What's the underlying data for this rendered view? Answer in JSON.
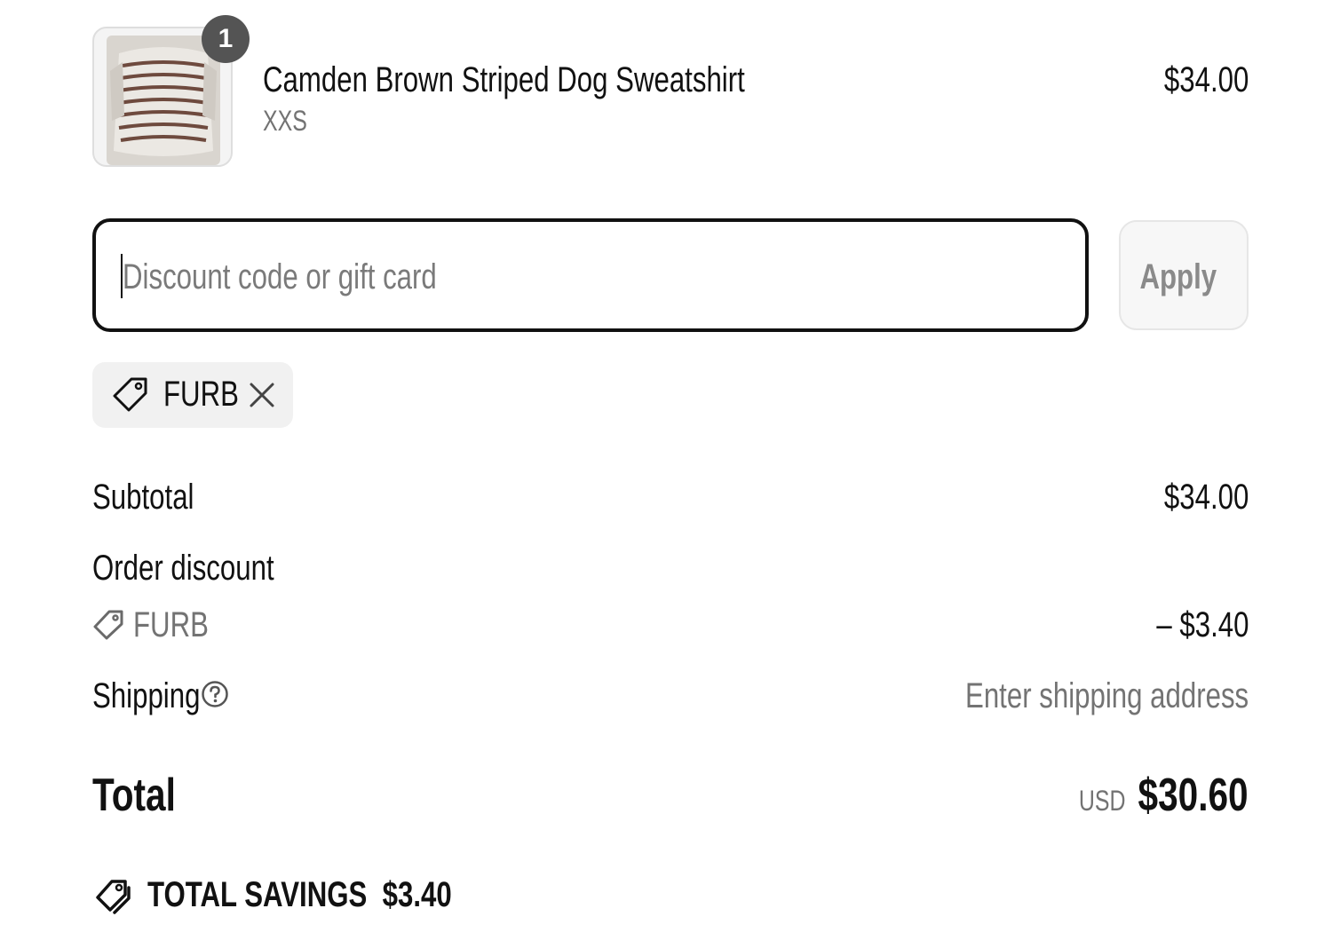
{
  "product": {
    "quantity": "1",
    "name": "Camden Brown Striped Dog Sweatshirt",
    "variant": "XXS",
    "price": "$34.00"
  },
  "discount": {
    "placeholder": "Discount code or gift card",
    "value": "",
    "apply_label": "Apply",
    "applied_code": "FURB"
  },
  "summary": {
    "subtotal_label": "Subtotal",
    "subtotal_value": "$34.00",
    "order_discount_label": "Order discount",
    "discount_code": "FURB",
    "discount_value": "– $3.40",
    "shipping_label": "Shipping",
    "shipping_value": "Enter shipping address",
    "total_label": "Total",
    "currency": "USD",
    "total_value": "$30.60",
    "savings_label": "TOTAL SAVINGS",
    "savings_value": "$3.40"
  },
  "icons": {
    "tag": "tag-icon",
    "close": "close-icon",
    "help": "help-circle-icon",
    "savings": "savings-tags-icon"
  },
  "colors": {
    "text": "#111111",
    "muted": "#737373",
    "badge": "#545454",
    "chip_bg": "#f1f1f1"
  }
}
